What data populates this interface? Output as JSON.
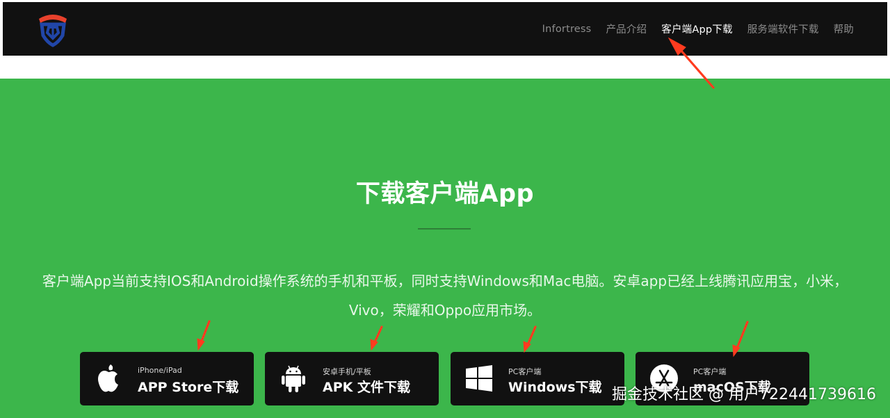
{
  "colors": {
    "navbar_bg": "#111111",
    "hero_bg": "#3cb64b",
    "button_bg": "#111111",
    "arrow": "#ff3b1f",
    "logo_red": "#e8412c",
    "logo_blue": "#2146a8"
  },
  "nav": {
    "items": [
      {
        "label": "Infortress",
        "active": false
      },
      {
        "label": "产品介绍",
        "active": false
      },
      {
        "label": "客户端App下载",
        "active": true
      },
      {
        "label": "服务端软件下载",
        "active": false
      },
      {
        "label": "帮助",
        "active": false
      }
    ]
  },
  "hero": {
    "title": "下载客户端App",
    "description": "客户端App当前支持IOS和Android操作系统的手机和平板，同时支持Windows和Mac电脑。安卓app已经上线腾讯应用宝，小米，Vivo，荣耀和Oppo应用市场。"
  },
  "downloads": [
    {
      "small": "iPhone/iPad",
      "big": "APP Store下载",
      "icon": "apple-icon"
    },
    {
      "small": "安卓手机/平板",
      "big": "APK 文件下载",
      "icon": "android-icon"
    },
    {
      "small": "PC客户端",
      "big": "Windows下载",
      "icon": "windows-icon"
    },
    {
      "small": "PC客户端",
      "big": "macOS下载",
      "icon": "app-store-icon"
    }
  ],
  "watermark": "掘金技术社区 @ 用户722441739616"
}
